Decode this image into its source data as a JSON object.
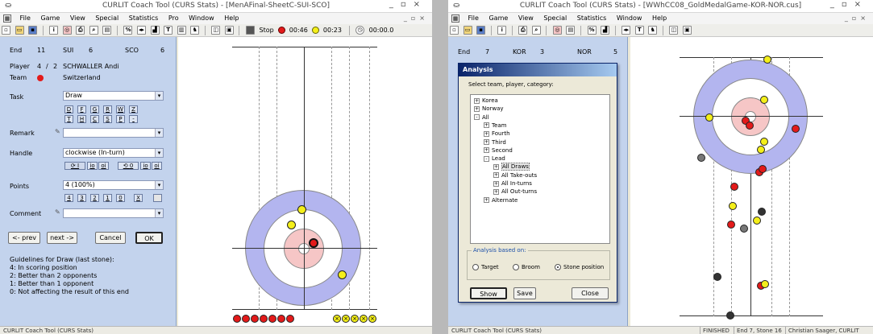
{
  "left": {
    "title": "CURLIT Coach Tool (CURS Stats) - [MenAFinal-SheetC-SUI-SCO]",
    "menu": [
      "File",
      "Game",
      "View",
      "Special",
      "Statistics",
      "Pro",
      "Window",
      "Help"
    ],
    "toolbar": {
      "stop_label": "Stop",
      "red_time": "00:46",
      "yellow_time": "00:23",
      "clock": "00:00.0"
    },
    "end_row": {
      "end_label": "End",
      "end": "11",
      "team1": "SUI",
      "score1": "6",
      "team2": "SCO",
      "score2": "6"
    },
    "player": {
      "label": "Player",
      "num": "4",
      "sep": "/",
      "total": "2",
      "name": "SCHWALLER Andi"
    },
    "team": {
      "label": "Team",
      "value": "Switzerland"
    },
    "task": {
      "label": "Task",
      "value": "Draw",
      "keys_row1": [
        "D",
        "F",
        "G",
        "R",
        "W",
        "Z"
      ],
      "keys_row2": [
        "T",
        "H",
        "C",
        "S",
        "P",
        "-"
      ]
    },
    "remark": {
      "label": "Remark",
      "value": ""
    },
    "handle": {
      "label": "Handle",
      "value": "clockwise (In-turn)",
      "keys": [
        "I",
        "io",
        "oi",
        "0",
        "io",
        "oi"
      ]
    },
    "points": {
      "label": "Points",
      "value": "4 (100%)",
      "keys": [
        "4",
        "3",
        "2",
        "1",
        "0",
        "X"
      ]
    },
    "comment": {
      "label": "Comment",
      "value": ""
    },
    "buttons": {
      "prev": "<- prev",
      "next": "next ->",
      "cancel": "Cancel",
      "ok": "OK"
    },
    "guide": [
      "Guidelines for  Draw (last stone):",
      "4: In scoring position",
      "2: Better than 2 opponents",
      "1: Better than 1 opponent",
      "0: Not affecting the result of this end"
    ],
    "status": "CURLIT Coach Tool (CURS Stats)",
    "colors": {
      "red": "#e31a1a",
      "yellow": "#f4ef1a",
      "ring12": "#b3b5ef",
      "ring4": "#f6c6c6"
    }
  },
  "right": {
    "title": "CURLIT Coach Tool (CURS Stats) - [WWhCC08_GoldMedalGame-KOR-NOR.cus]",
    "menu": [
      "File",
      "Game",
      "View",
      "Special",
      "Statistics",
      "Window",
      "Help"
    ],
    "end_row": {
      "end_label": "End",
      "end": "7",
      "team1": "KOR",
      "score1": "3",
      "team2": "NOR",
      "score2": "5"
    },
    "status": {
      "left": "CURLIT Coach Tool (CURS Stats)",
      "state": "FINISHED",
      "pos": "End 7, Stone 16",
      "user": "Christian Saager, CURLIT"
    }
  },
  "dialog": {
    "title": "Analysis",
    "prompt": "Select team, player, category:",
    "tree": [
      {
        "label": "Korea",
        "level": 0,
        "sign": "+"
      },
      {
        "label": "Norway",
        "level": 0,
        "sign": "+"
      },
      {
        "label": "All",
        "level": 0,
        "sign": "-"
      },
      {
        "label": "Team",
        "level": 1,
        "sign": "+"
      },
      {
        "label": "Fourth",
        "level": 1,
        "sign": "+"
      },
      {
        "label": "Third",
        "level": 1,
        "sign": "+"
      },
      {
        "label": "Second",
        "level": 1,
        "sign": "+"
      },
      {
        "label": "Lead",
        "level": 1,
        "sign": "-"
      },
      {
        "label": "All Draws",
        "level": 2,
        "sign": "+"
      },
      {
        "label": "All Take-outs",
        "level": 2,
        "sign": "+"
      },
      {
        "label": "All In-turns",
        "level": 2,
        "sign": "+"
      },
      {
        "label": "All Out-turns",
        "level": 2,
        "sign": "+"
      },
      {
        "label": "Alternate",
        "level": 1,
        "sign": "+"
      }
    ],
    "group_label": "Analysis based on:",
    "options": [
      "Target",
      "Broom",
      "Stone position"
    ],
    "selected": "Stone position",
    "buttons": {
      "show": "Show",
      "save": "Save",
      "close": "Close"
    }
  }
}
